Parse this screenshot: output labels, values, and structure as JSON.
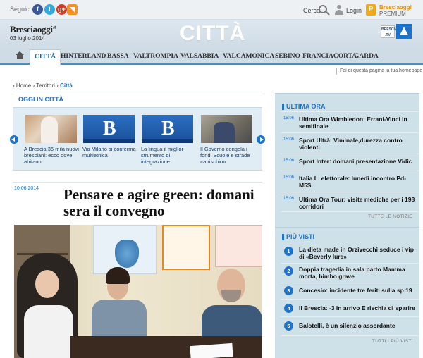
{
  "topbar": {
    "follow_label": "Seguici...",
    "social": [
      {
        "name": "facebook",
        "glyph": "f"
      },
      {
        "name": "twitter",
        "glyph": "t"
      },
      {
        "name": "googleplus",
        "glyph": "g+"
      },
      {
        "name": "rss",
        "glyph": "◥"
      }
    ],
    "search_label": "Cerca",
    "login_label": "Login",
    "premium_brand": "Bresciaoggi",
    "premium_label": "PREMIUM"
  },
  "header": {
    "logo": "Bresciaoggi",
    "date": "03 luglio 2014",
    "section_title": "CITTÀ",
    "tv_badge": "BRESCIA .TV"
  },
  "nav": {
    "items": [
      "CITTÀ",
      "HINTERLAND",
      "BASSA",
      "VALTROMPIA",
      "VALSABBIA",
      "VALCAMONICA",
      "SEBINO-FRANCIACORTA",
      "GARDA"
    ],
    "active_index": 0
  },
  "homepage_link": "Fai di questa pagina la tua homepage",
  "breadcrumb": {
    "items": [
      "Home",
      "Territori",
      "Città"
    ],
    "separator": "›"
  },
  "oggi": {
    "title": "OGGI IN CITTÀ",
    "items": [
      {
        "caption": "A Brescia 36 mila nuovi bresciani: ecco dove abitano",
        "thumb": "photo"
      },
      {
        "caption": "Via Milano si conferma multietnica",
        "thumb": "logo-b"
      },
      {
        "caption": "La lingua il miglior strumento di integrazione",
        "thumb": "logo-b"
      },
      {
        "caption": "Il Governo congela i fondi Scuole e strade «a rischio»",
        "thumb": "photo"
      }
    ]
  },
  "article": {
    "date": "10.06.2014",
    "title": "Pensare e agire green: domani sera il convegno"
  },
  "ultima_ora": {
    "title": "ULTIMA ORA",
    "items": [
      {
        "time": "15:06",
        "text": "Ultima Ora Wimbledon: Errani-Vinci in semifinale"
      },
      {
        "time": "15:06",
        "text": "Sport Ultrà: Viminale,durezza contro violenti"
      },
      {
        "time": "15:06",
        "text": "Sport Inter: domani presentazione Vidic"
      },
      {
        "time": "15:06",
        "text": "Italia L. elettorale: lunedì incontro Pd-M5S"
      },
      {
        "time": "15:06",
        "text": "Ultima Ora Tour: visite mediche per i 198 corridori"
      }
    ],
    "more": "TUTTE LE NOTIZIE"
  },
  "piu_visti": {
    "title": "PIÙ VISTI",
    "items": [
      {
        "rank": "1",
        "text": "La dieta made in Orzivecchi seduce i vip di «Beverly Iurs»"
      },
      {
        "rank": "2",
        "text": "Doppia tragedia in sala parto Mamma morta, bimbo grave"
      },
      {
        "rank": "3",
        "text": "Concesio: incidente tre feriti sulla sp 19"
      },
      {
        "rank": "4",
        "text": "Il Brescia: -3 in arrivo E rischia di sparire"
      },
      {
        "rank": "5",
        "text": "Balotelli, è un silenzio assordante"
      }
    ],
    "more": "TUTTI I PIÙ VISTI"
  },
  "colors": {
    "accent": "#1d72c9",
    "sidebar_bg": "#cfe1e8",
    "nav_bg": "#cfdbe5"
  }
}
